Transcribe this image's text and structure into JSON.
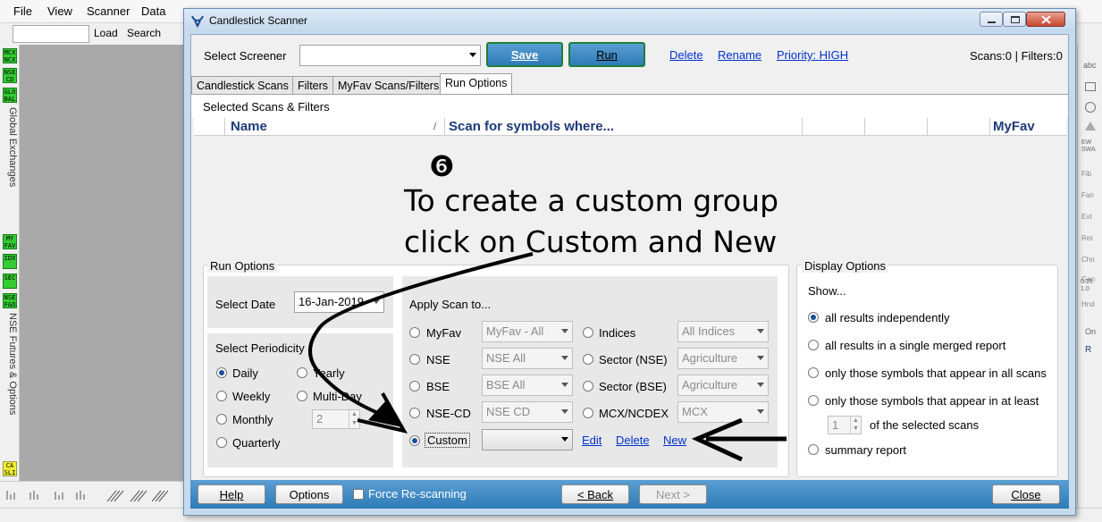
{
  "menu": [
    "File",
    "View",
    "Scanner",
    "Data"
  ],
  "toolbar2": {
    "load": "Load",
    "search": "Search"
  },
  "left_labels": {
    "global": "Global Exchanges",
    "nse_fo": "NSE Futures & Options"
  },
  "left_badges": [
    "MCX NCX",
    "NSE CD",
    "GLO BAL",
    "MY FAV",
    "IDX",
    "SEC",
    "NSE F&O",
    "CA SLI"
  ],
  "right_tools": [
    "abc",
    "EW SWA",
    "Fib",
    "Fan",
    "Ext",
    "Ret",
    "Chn",
    "Gan",
    "0.25 1.0",
    "Hnd",
    "On",
    "R"
  ],
  "window": {
    "title": "Candlestick Scanner"
  },
  "screener": {
    "label": "Select Screener",
    "value": "",
    "save": "Save",
    "run": "Run",
    "delete": "Delete",
    "rename": "Rename",
    "priority": "Priority: HIGH",
    "counts": "Scans:0 | Filters:0"
  },
  "tabs": [
    "Candlestick Scans",
    "Filters",
    "MyFav Scans/Filters",
    "Run Options"
  ],
  "selected": {
    "title": "Selected Scans & Filters",
    "col_name": "Name",
    "col_sort": "/",
    "col_scan": "Scan for symbols where...",
    "col_myfav": "MyFav"
  },
  "annotation": {
    "step": "❻",
    "line1": "To create a custom group",
    "line2": "click on Custom and New"
  },
  "run_options": {
    "title": "Run Options",
    "date_label": "Select Date",
    "date_value": "16-Jan-2019",
    "periodicity_label": "Select Periodicity",
    "daily": "Daily",
    "weekly": "Weekly",
    "monthly": "Monthly",
    "quarterly": "Quarterly",
    "yearly": "Yearly",
    "multiday": "Multi-Day",
    "multiday_value": "2"
  },
  "apply": {
    "title": "Apply Scan to...",
    "myfav": "MyFav",
    "myfav_val": "MyFav - All",
    "nse": "NSE",
    "nse_val": "NSE All",
    "bse": "BSE",
    "bse_val": "BSE All",
    "nsecd": "NSE-CD",
    "nsecd_val": "NSE CD",
    "custom": "Custom",
    "custom_val": "",
    "indices": "Indices",
    "indices_val": "All Indices",
    "sector_nse": "Sector (NSE)",
    "sector_nse_val": "Agriculture",
    "sector_bse": "Sector (BSE)",
    "sector_bse_val": "Agriculture",
    "mcx": "MCX/NCDEX",
    "mcx_val": "MCX",
    "edit": "Edit",
    "delete": "Delete",
    "new": "New"
  },
  "display": {
    "title": "Display Options",
    "show": "Show...",
    "o1": "all results independently",
    "o2": "all results in a single merged report",
    "o3": "only those symbols that appear in all scans",
    "o4": "only those symbols that appear in at least",
    "o4_value": "1",
    "o4_suffix": "of the selected scans",
    "o5": "summary report"
  },
  "footer": {
    "help": "Help",
    "options": "Options",
    "force": "Force Re-scanning",
    "back": "< Back",
    "next": "Next >",
    "close": "Close"
  },
  "colors": {
    "accent": "#2e7bb7",
    "header_text": "#1d3a7a",
    "save_green": "#1e7f3a"
  }
}
